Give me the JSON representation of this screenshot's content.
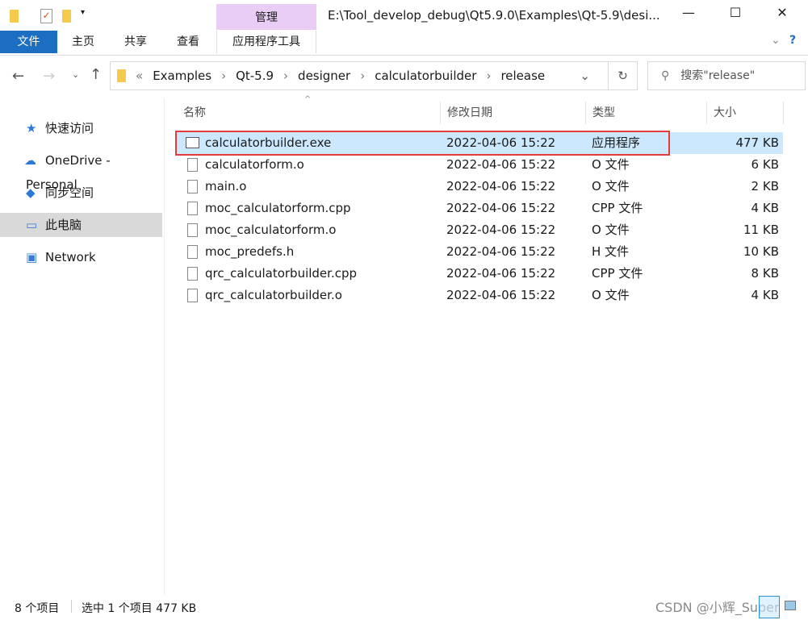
{
  "window": {
    "title": "E:\\Tool_develop_debug\\Qt5.9.0\\Examples\\Qt-5.9\\desi...",
    "minimize": "—",
    "maximize": "☐",
    "close": "✕"
  },
  "ribbon": {
    "context_group": "管理",
    "tabs": [
      "文件",
      "主页",
      "共享",
      "查看",
      "应用程序工具"
    ]
  },
  "address": {
    "prefix": "«",
    "crumbs": [
      "Examples",
      "Qt-5.9",
      "designer",
      "calculatorbuilder",
      "release"
    ],
    "search_placeholder": "搜索\"release\""
  },
  "nav": [
    "快速访问",
    "OneDrive - Personal",
    "同步空间",
    "此电脑",
    "Network"
  ],
  "columns": [
    "名称",
    "修改日期",
    "类型",
    "大小"
  ],
  "files": [
    {
      "name": "calculatorbuilder.exe",
      "date": "2022-04-06 15:22",
      "type": "应用程序",
      "size": "477 KB"
    },
    {
      "name": "calculatorform.o",
      "date": "2022-04-06 15:22",
      "type": "O 文件",
      "size": "6 KB"
    },
    {
      "name": "main.o",
      "date": "2022-04-06 15:22",
      "type": "O 文件",
      "size": "2 KB"
    },
    {
      "name": "moc_calculatorform.cpp",
      "date": "2022-04-06 15:22",
      "type": "CPP 文件",
      "size": "4 KB"
    },
    {
      "name": "moc_calculatorform.o",
      "date": "2022-04-06 15:22",
      "type": "O 文件",
      "size": "11 KB"
    },
    {
      "name": "moc_predefs.h",
      "date": "2022-04-06 15:22",
      "type": "H 文件",
      "size": "10 KB"
    },
    {
      "name": "qrc_calculatorbuilder.cpp",
      "date": "2022-04-06 15:22",
      "type": "CPP 文件",
      "size": "8 KB"
    },
    {
      "name": "qrc_calculatorbuilder.o",
      "date": "2022-04-06 15:22",
      "type": "O 文件",
      "size": "4 KB"
    }
  ],
  "status": {
    "count": "8 个项目",
    "selected": "选中 1 个项目  477 KB"
  },
  "watermark": "CSDN @小辉_Super",
  "colors": {
    "accent": "#1b6ec2",
    "selection": "#cce8ff",
    "highlight_box": "#e8393b",
    "context_tab": "#e9cdf7"
  }
}
